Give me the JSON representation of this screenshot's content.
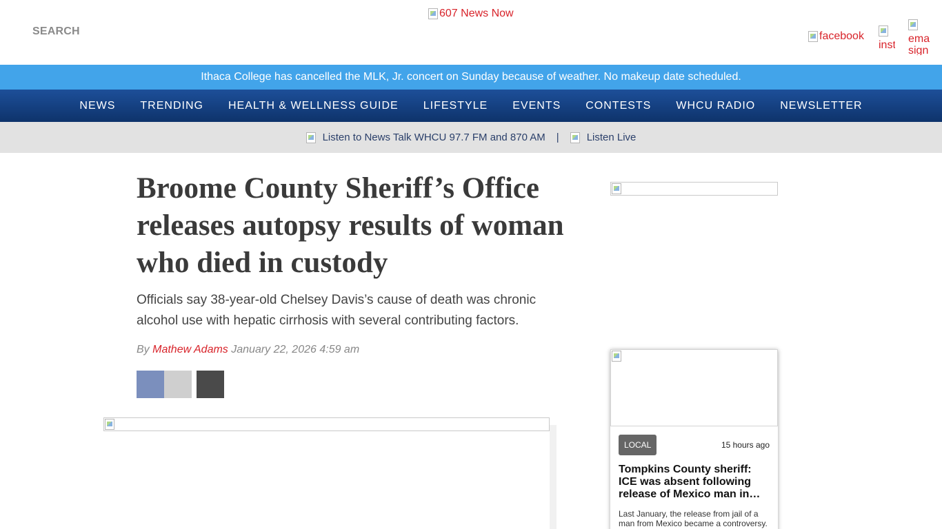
{
  "header": {
    "search_label": "SEARCH",
    "logo_alt": "607 News Now",
    "social": {
      "facebook_alt": "facebook",
      "instagram_alt": "inst",
      "email_alt": "ema sign"
    }
  },
  "alert": {
    "text": "Ithaca College has cancelled the MLK, Jr. concert on Sunday because of weather. No makeup date scheduled."
  },
  "nav": {
    "items": [
      "NEWS",
      "TRENDING",
      "HEALTH & WELLNESS GUIDE",
      "LIFESTYLE",
      "EVENTS",
      "CONTESTS",
      "WHCU RADIO",
      "NEWSLETTER"
    ]
  },
  "listen_bar": {
    "station_text": "Listen to News Talk WHCU 97.7 FM and 870 AM",
    "separator": "|",
    "live_text": "Listen Live"
  },
  "article": {
    "headline": "Broome County Sheriff’s Office releases autopsy results of woman who died in custody",
    "dek": "Officials say 38-year-old Chelsey Davis’s cause of death was chronic alcohol use with hepatic cirrhosis with several contributing factors.",
    "by_prefix": "By",
    "author": "Mathew Adams",
    "date": "January 22, 2026 4:59 am"
  },
  "sidebar": {
    "card": {
      "tag": "LOCAL",
      "time": "15 hours ago",
      "title": "Tompkins County sheriff: ICE was absent following release of Mexico man in…",
      "summary": "Last January, the release from jail of a man from Mexico became a controversy."
    }
  },
  "colors": {
    "accent_red": "#d8232a",
    "alert_blue": "#42a4ea",
    "nav_blue": "#0e336b",
    "listen_gray": "#e2e2e2"
  }
}
